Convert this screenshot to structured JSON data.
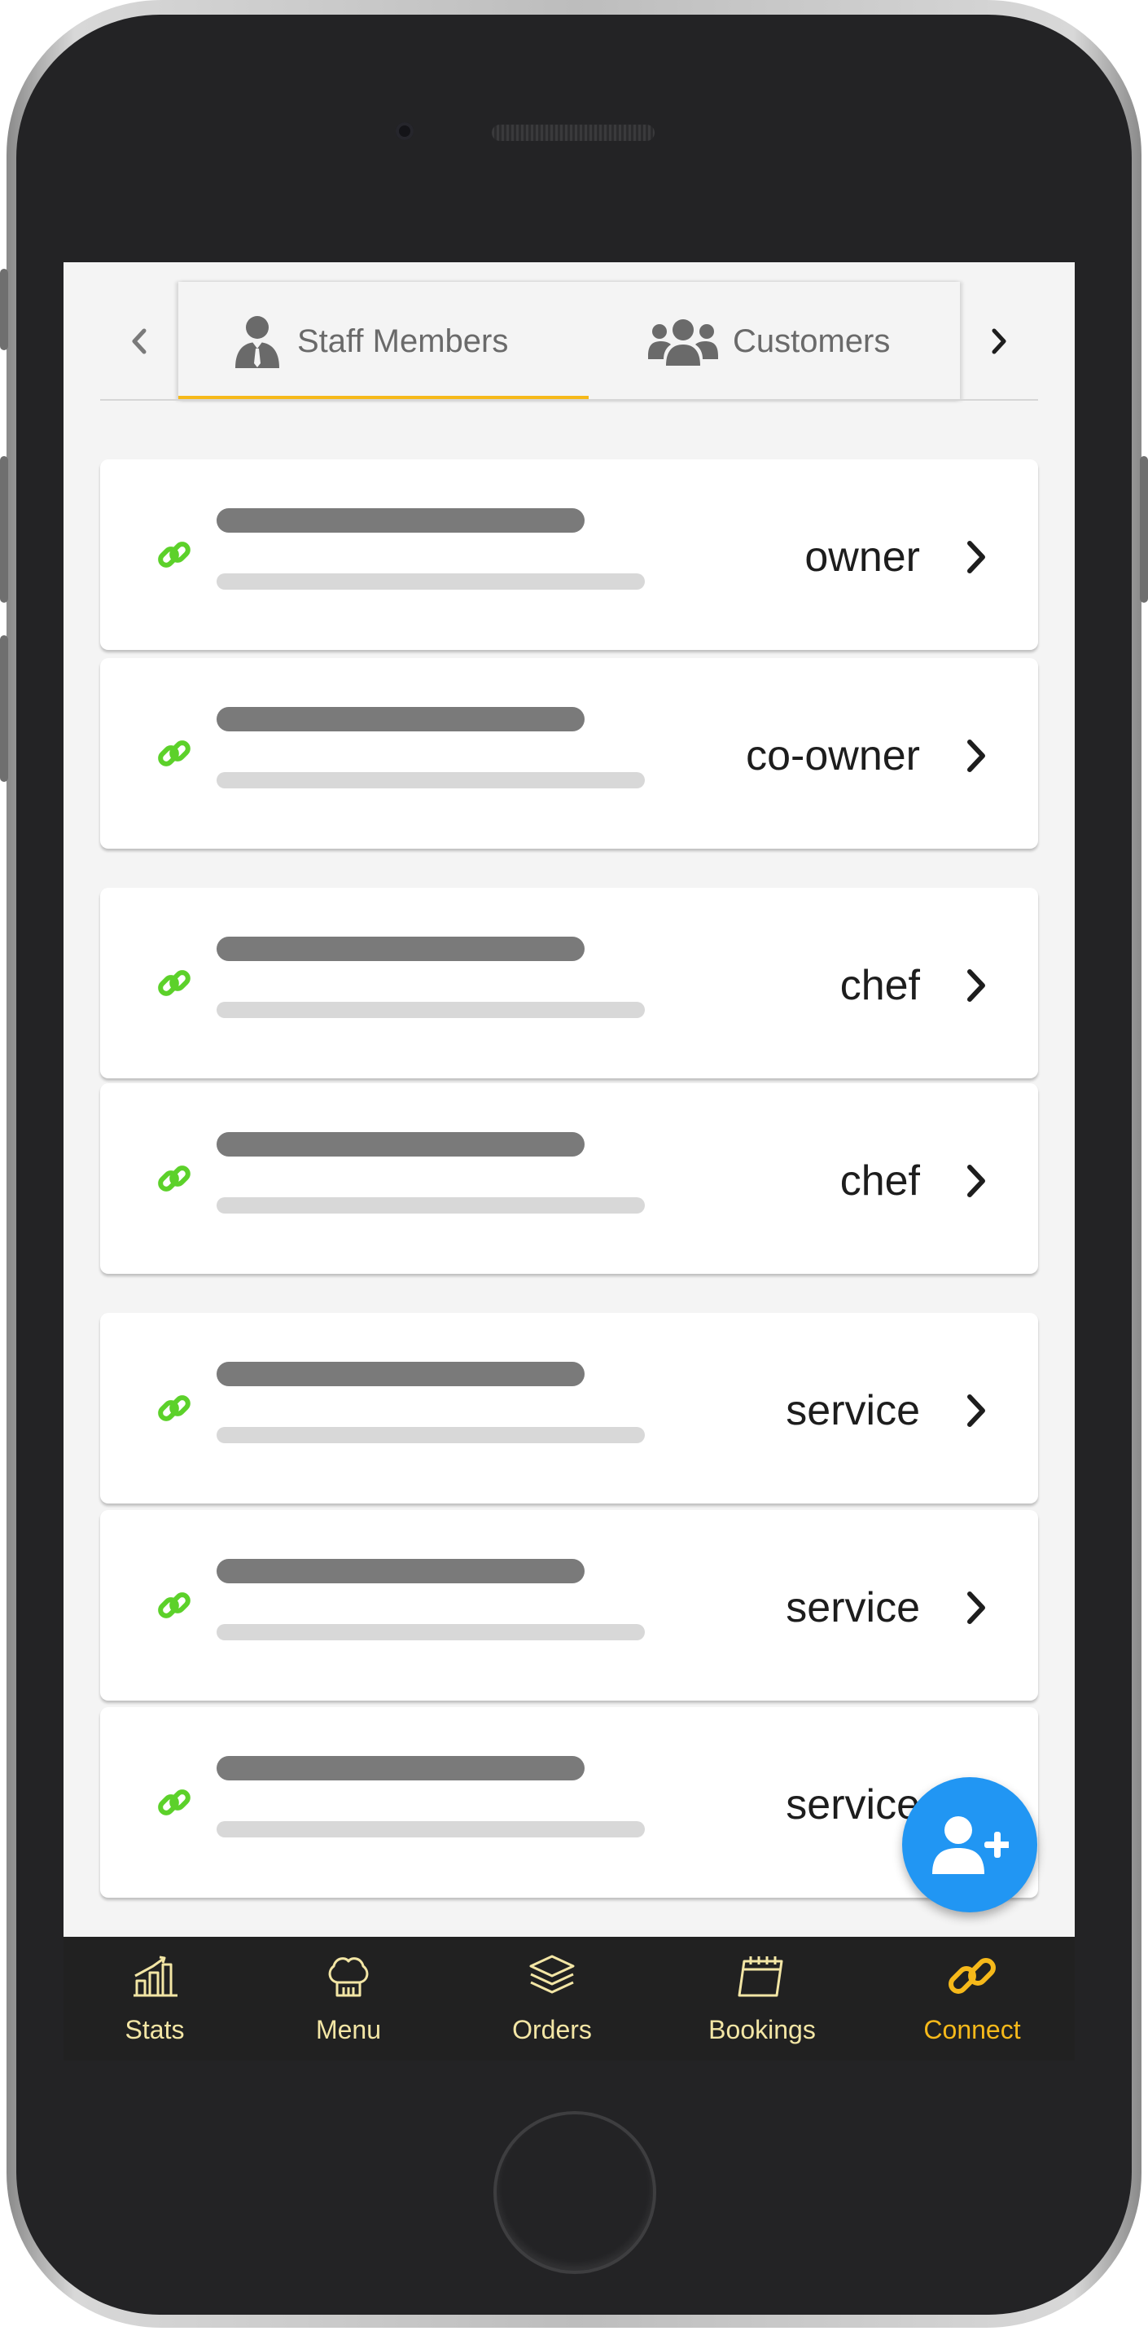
{
  "colors": {
    "accent": "#f6b91a",
    "fab": "#2196f3",
    "link_icon": "#5cd12a",
    "nav_background": "#212121",
    "nav_label": "#f3e6a5"
  },
  "tabs": {
    "prev_icon": "chevron-left-icon",
    "next_icon": "chevron-right-icon",
    "items": [
      {
        "label": "Staff Members",
        "icon": "user-tie-icon",
        "active": true
      },
      {
        "label": "Customers",
        "icon": "users-icon",
        "active": false
      }
    ]
  },
  "members": [
    {
      "role": "owner"
    },
    {
      "role": "co-owner"
    },
    {
      "role": "chef"
    },
    {
      "role": "chef"
    },
    {
      "role": "service"
    },
    {
      "role": "service"
    },
    {
      "role": "service"
    }
  ],
  "fab": {
    "icon": "add-user-icon"
  },
  "nav": {
    "items": [
      {
        "label": "Stats",
        "icon": "chart-icon",
        "active": false
      },
      {
        "label": "Menu",
        "icon": "chef-hat-icon",
        "active": false
      },
      {
        "label": "Orders",
        "icon": "layers-icon",
        "active": false
      },
      {
        "label": "Bookings",
        "icon": "calendar-icon",
        "active": false
      },
      {
        "label": "Connect",
        "icon": "link-icon",
        "active": true
      }
    ]
  }
}
